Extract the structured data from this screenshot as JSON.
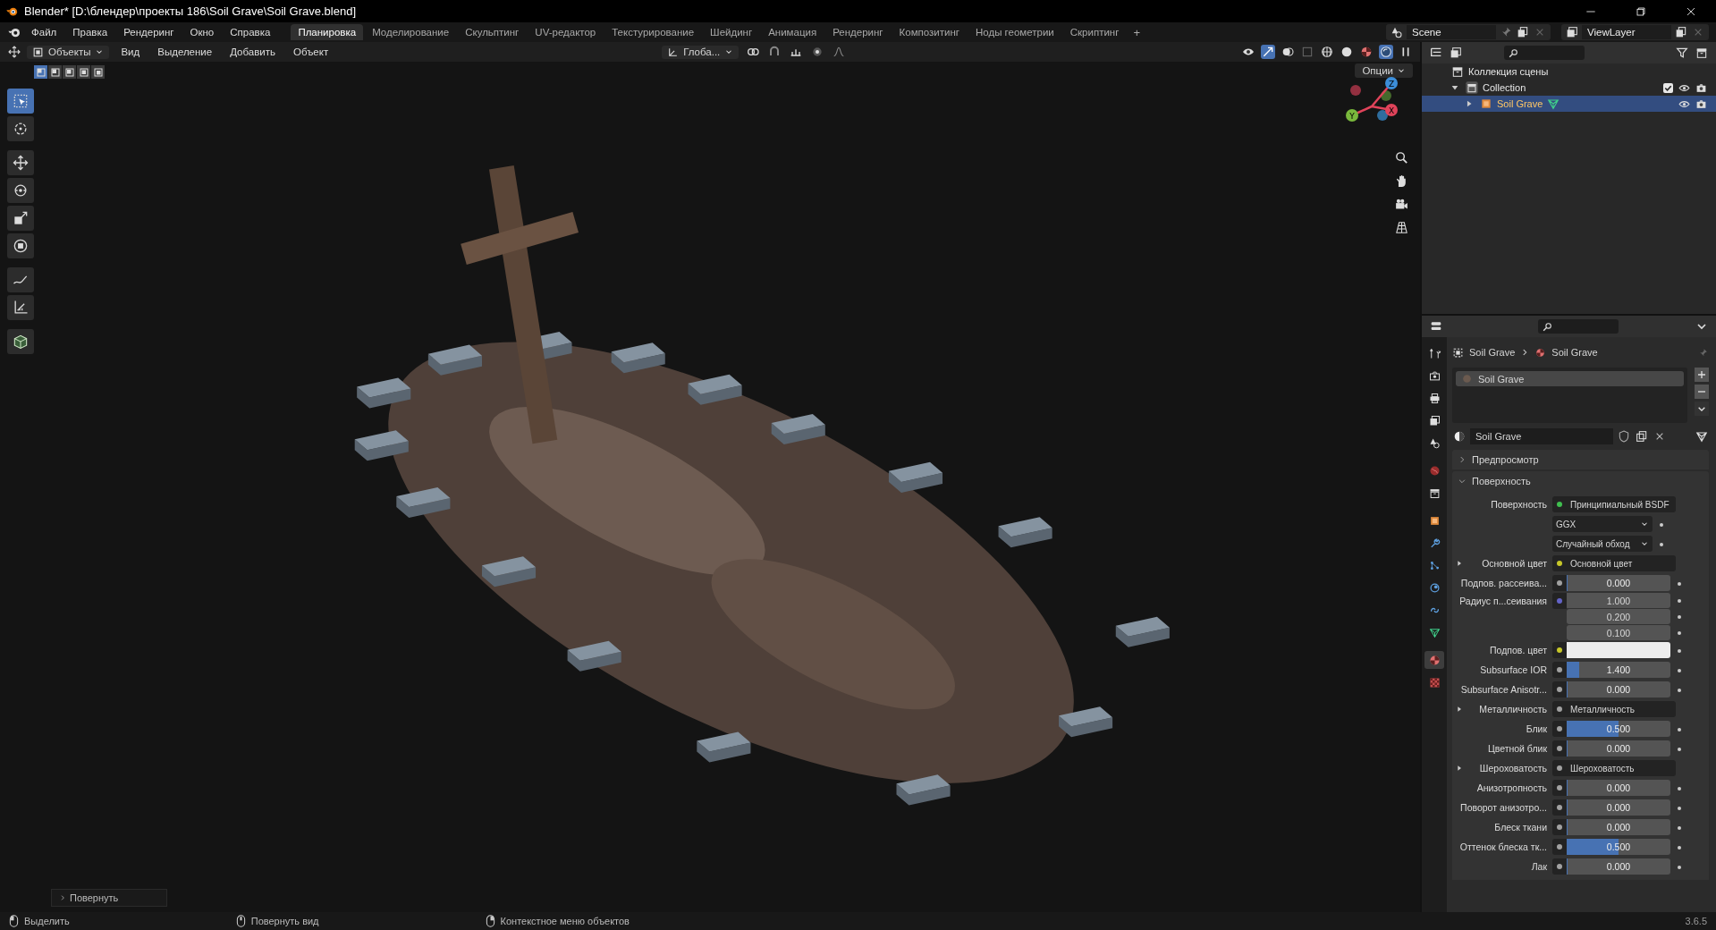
{
  "window": {
    "title": "Blender* [D:\\блендер\\проекты 186\\Soil Grave\\Soil Grave.blend]"
  },
  "menu": [
    "Файл",
    "Правка",
    "Рендеринг",
    "Окно",
    "Справка"
  ],
  "workspaces": [
    {
      "label": "Планировка",
      "selected": true
    },
    {
      "label": "Моделирование",
      "selected": false
    },
    {
      "label": "Скульптинг",
      "selected": false
    },
    {
      "label": "UV-редактор",
      "selected": false
    },
    {
      "label": "Текстурирование",
      "selected": false
    },
    {
      "label": "Шейдинг",
      "selected": false
    },
    {
      "label": "Анимация",
      "selected": false
    },
    {
      "label": "Рендеринг",
      "selected": false
    },
    {
      "label": "Композитинг",
      "selected": false
    },
    {
      "label": "Ноды геометрии",
      "selected": false
    },
    {
      "label": "Скриптинг",
      "selected": false
    }
  ],
  "add_workspace": "+",
  "scene": {
    "name": "Scene"
  },
  "view_layer": {
    "name": "ViewLayer"
  },
  "viewport": {
    "editor_mode": "Объекты",
    "menus": [
      "Вид",
      "Выделение",
      "Добавить",
      "Объект"
    ],
    "transform_orientation": "Глоба...",
    "options": "Опции",
    "select_modes": [
      {
        "selected": true
      },
      {
        "selected": false
      },
      {
        "selected": false
      },
      {
        "selected": false
      },
      {
        "selected": false
      }
    ],
    "tools": [
      {
        "kind": "select",
        "selected": true
      },
      {
        "kind": "cursor",
        "selected": false
      },
      {
        "kind": "move",
        "selected": false
      },
      {
        "kind": "rotate",
        "selected": false
      },
      {
        "kind": "scale",
        "selected": false
      },
      {
        "kind": "transform",
        "selected": false
      },
      {
        "kind": "annotate",
        "selected": false
      },
      {
        "kind": "measure",
        "selected": false
      },
      {
        "kind": "cube",
        "selected": false
      }
    ],
    "shading": [
      {
        "kind": "wireframe",
        "selected": false
      },
      {
        "kind": "solid",
        "selected": false
      },
      {
        "kind": "material",
        "selected": false
      },
      {
        "kind": "rendered",
        "selected": true
      }
    ],
    "gizmo": [
      {
        "label": "X",
        "color": "#e0435a"
      },
      {
        "label": "Y",
        "color": "#79b83c"
      },
      {
        "label": "Z",
        "color": "#3c8ed9"
      }
    ],
    "last_operator": "Повернуть"
  },
  "outliner": {
    "items": [
      {
        "label": "Коллекция сцены",
        "kind": "scene",
        "selected": false,
        "children": [
          {
            "label": "Collection",
            "kind": "collection",
            "expanded": true,
            "checked": true,
            "selected": false,
            "children": [
              {
                "label": "Soil Grave",
                "kind": "object",
                "expanded": false,
                "selected": true
              }
            ]
          }
        ]
      }
    ]
  },
  "properties": {
    "breadcrumb": [
      "Soil Grave",
      "Soil Grave"
    ],
    "tabs": [
      {
        "kind": "tool",
        "selected": false
      },
      {
        "kind": "render",
        "selected": false
      },
      {
        "kind": "output",
        "selected": false
      },
      {
        "kind": "viewlayer",
        "selected": false
      },
      {
        "kind": "scene",
        "selected": false
      },
      {
        "kind": "world",
        "selected": false
      },
      {
        "kind": "collection",
        "selected": false
      },
      {
        "kind": "object",
        "selected": false
      },
      {
        "kind": "modifier",
        "selected": false
      },
      {
        "kind": "particles",
        "selected": false
      },
      {
        "kind": "physics",
        "selected": false
      },
      {
        "kind": "constraint",
        "selected": false
      },
      {
        "kind": "data",
        "selected": false
      },
      {
        "kind": "material",
        "selected": true
      },
      {
        "kind": "texture",
        "selected": false
      }
    ],
    "material_slots": [
      {
        "label": "Soil Grave",
        "selected": true
      }
    ],
    "material": "Soil Grave",
    "panels": [
      {
        "label": "Предпросмотр",
        "expanded": false
      },
      {
        "label": "Поверхность",
        "expanded": true,
        "rows": [
          {
            "kind": "link",
            "label": "Поверхность",
            "value": "Принципиальный BSDF",
            "color": "#3fbf4f"
          },
          {
            "kind": "dropdown",
            "value": "GGX"
          },
          {
            "kind": "dropdown",
            "value": "Случайный обход"
          },
          {
            "kind": "link",
            "label": "Основной цвет",
            "value": "Основной цвет",
            "color": "#c7c729",
            "expanded": false
          },
          {
            "kind": "slider",
            "label": "Подпов. рассеива...",
            "value": "0.000",
            "level": 0,
            "color": "#a1a1a1"
          },
          {
            "kind": "vector",
            "label": "Радиус п...сеивания",
            "values": [
              "1.000",
              "0.200",
              "0.100"
            ],
            "color": "#6363c7"
          },
          {
            "kind": "color",
            "label": "Подпов. цвет",
            "color": "#c7c729"
          },
          {
            "kind": "slider",
            "label": "Subsurface IOR",
            "value": "1.400",
            "level": 0.12,
            "color": "#a1a1a1"
          },
          {
            "kind": "slider",
            "label": "Subsurface Anisotr...",
            "value": "0.000",
            "level": 0,
            "color": "#a1a1a1"
          },
          {
            "kind": "link",
            "label": "Металличность",
            "value": "Металличность",
            "color": "#a1a1a1",
            "expanded": false
          },
          {
            "kind": "slider",
            "label": "Блик",
            "value": "0.500",
            "level": 0.5,
            "color": "#a1a1a1"
          },
          {
            "kind": "slider",
            "label": "Цветной блик",
            "value": "0.000",
            "level": 0,
            "color": "#a1a1a1"
          },
          {
            "kind": "link",
            "label": "Шероховатость",
            "value": "Шероховатость",
            "color": "#a1a1a1",
            "expanded": false
          },
          {
            "kind": "slider",
            "label": "Анизотропность",
            "value": "0.000",
            "level": 0,
            "color": "#a1a1a1"
          },
          {
            "kind": "slider",
            "label": "Поворот анизотро...",
            "value": "0.000",
            "level": 0,
            "color": "#a1a1a1"
          },
          {
            "kind": "slider",
            "label": "Блеск ткани",
            "value": "0.000",
            "level": 0,
            "color": "#a1a1a1"
          },
          {
            "kind": "slider",
            "label": "Оттенок блеска тк...",
            "value": "0.500",
            "level": 0.5,
            "color": "#a1a1a1"
          },
          {
            "kind": "slider",
            "label": "Лак",
            "value": "0.000",
            "level": 0,
            "color": "#a1a1a1"
          }
        ]
      }
    ]
  },
  "status_bar": {
    "hints": [
      {
        "kind": "left",
        "label": "Выделить"
      },
      {
        "kind": "middle",
        "label": "Повернуть вид"
      },
      {
        "kind": "right",
        "label": "Контекстное меню объектов"
      }
    ],
    "version": "3.6.5"
  }
}
